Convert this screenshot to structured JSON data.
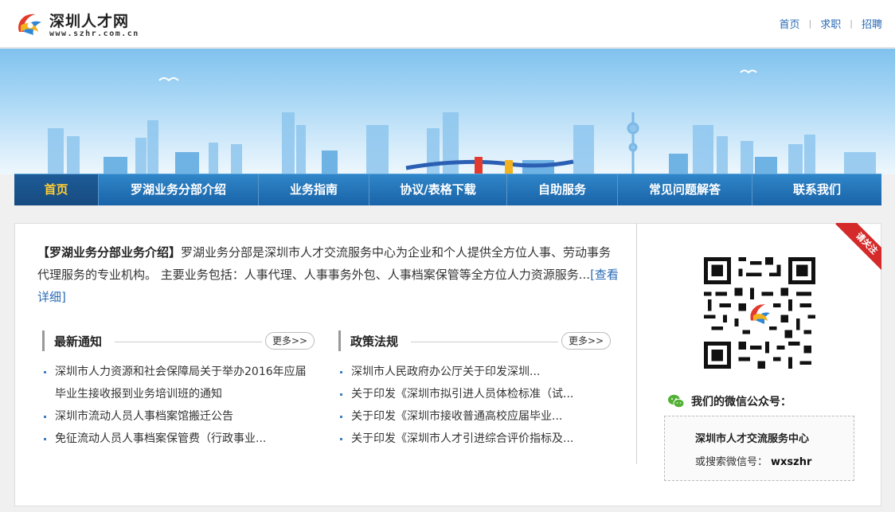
{
  "header": {
    "logo_title": "深圳人才网",
    "logo_url": "www.szhr.com.cn",
    "links": [
      "首页",
      "求职",
      "招聘"
    ]
  },
  "nav": {
    "items": [
      "首页",
      "罗湖业务分部介绍",
      "业务指南",
      "协议/表格下载",
      "自助服务",
      "常见问题解答",
      "联系我们"
    ],
    "active": "首页"
  },
  "intro": {
    "title": "【罗湖业务分部业务介绍】",
    "text": "罗湖业务分部是深圳市人才交流服务中心为企业和个人提供全方位人事、劳动事务代理服务的专业机构。 主要业务包括：人事代理、人事事务外包、人事档案保管等全方位人力资源服务...",
    "detail_link": "[查看详细]"
  },
  "notice": {
    "title": "最新通知",
    "more": "更多>>",
    "items": [
      "深圳市人力资源和社会保障局关于举办2016年应届毕业生接收报到业务培训班的通知",
      "深圳市流动人员人事档案馆搬迁公告",
      "免征流动人员人事档案保管费（行政事业..."
    ]
  },
  "policy": {
    "title": "政策法规",
    "more": "更多>>",
    "items": [
      "深圳市人民政府办公厅关于印发深圳...",
      "关于印发《深圳市拟引进人员体检标准（试...",
      "关于印发《深圳市接收普通高校应届毕业...",
      "关于印发《深圳市人才引进综合评价指标及..."
    ]
  },
  "wechat": {
    "ribbon": "请关注",
    "title": "我们的微信公众号：",
    "account_name": "深圳市人才交流服务中心",
    "search_label": "或搜索微信号：",
    "search_id": "wxszhr"
  },
  "colors": {
    "nav_blue": "#1f6db3",
    "nav_active_text": "#ffcc33",
    "link_blue": "#2a6bb5",
    "ribbon_red": "#d42a2a"
  }
}
